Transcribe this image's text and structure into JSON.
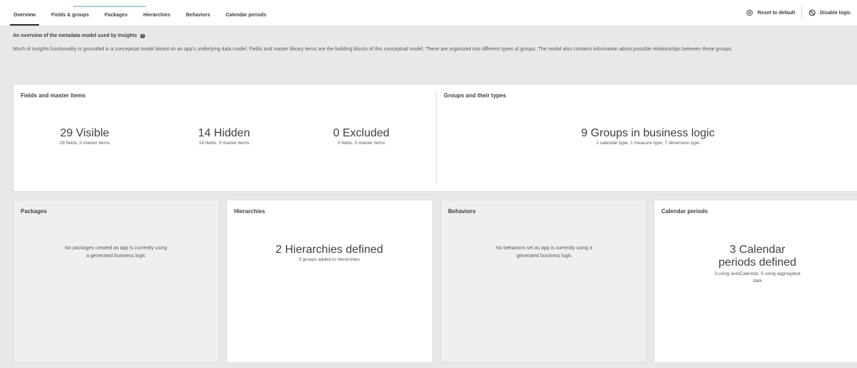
{
  "tabs": [
    "Overview",
    "Fields & groups",
    "Packages",
    "Hierarchies",
    "Behaviors",
    "Calendar periods"
  ],
  "actions": {
    "reset_label": "Reset to default",
    "disable_label": "Disable logic"
  },
  "intro": {
    "title": "An overview of the metadata model used by Insights",
    "description": "Much of Insights functionality is grounded in a conceptual model based on an app's underlying data model. Fields and master library items are the building blocks of this conceptual model. These are organized into different types of groups. The model also contains information about possible relationships between these groups."
  },
  "fields_card": {
    "title": "Fields and master items",
    "visible": {
      "big": "29 Visible",
      "small": "29 fields, 0 master items"
    },
    "hidden": {
      "big": "14 Hidden",
      "small": "14 fields, 0 master items"
    },
    "excluded": {
      "big": "0 Excluded",
      "small": "0 fields, 0 master items"
    }
  },
  "groups_card": {
    "title": "Groups and their types",
    "big": "9 Groups in business logic",
    "small": "1 calendar type, 1 measure type, 7 dimension type"
  },
  "packages_card": {
    "title": "Packages",
    "message": "No packages created as app is currently using a generated business logic"
  },
  "hierarchies_card": {
    "title": "Hierarchies",
    "big": "2 Hierarchies defined",
    "small": "3 groups added to hierarchies"
  },
  "behaviors_card": {
    "title": "Behaviors",
    "message": "No behaviors set as app is currently using a generated business logic"
  },
  "calendar_card": {
    "title": "Calendar periods",
    "big": "3 Calendar periods defined",
    "small": "3 using autoCalendar, 0 using aggregated date"
  },
  "icons": {
    "reset": "reset-icon",
    "disable": "disable-icon",
    "help": "help-icon"
  },
  "colors": {
    "tab_accent": "#a9cfd8",
    "background": "#e8e8e8"
  }
}
